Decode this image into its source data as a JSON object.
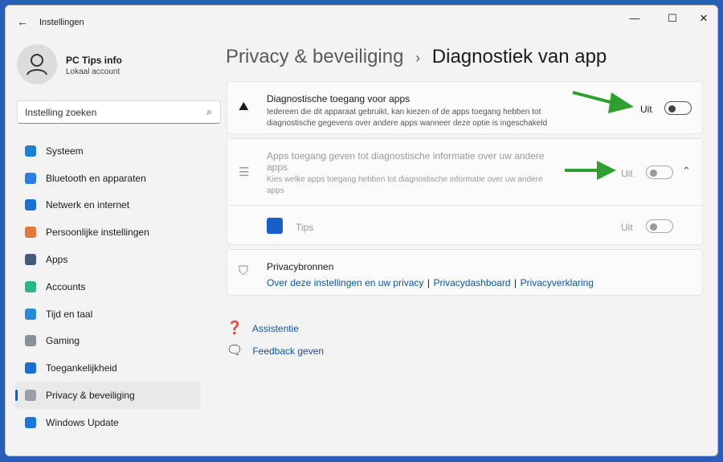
{
  "window": {
    "title": "Instellingen",
    "minimize": "—",
    "maximize": "☐",
    "close": "✕"
  },
  "user": {
    "name": "PC Tips info",
    "type": "Lokaal account"
  },
  "search": {
    "placeholder": "Instelling zoeken"
  },
  "sidebar": {
    "items": [
      {
        "label": "Systeem",
        "color": "#1f7fd0"
      },
      {
        "label": "Bluetooth en apparaten",
        "color": "#2b7de0"
      },
      {
        "label": "Netwerk en internet",
        "color": "#1d6fd6"
      },
      {
        "label": "Persoonlijke instellingen",
        "color": "#e07a3a"
      },
      {
        "label": "Apps",
        "color": "#445a7a"
      },
      {
        "label": "Accounts",
        "color": "#2bb58a"
      },
      {
        "label": "Tijd en taal",
        "color": "#2a8ad8"
      },
      {
        "label": "Gaming",
        "color": "#8a9098"
      },
      {
        "label": "Toegankelijkheid",
        "color": "#1a6fd0"
      },
      {
        "label": "Privacy & beveiliging",
        "color": "#9a9ea6",
        "selected": true
      },
      {
        "label": "Windows Update",
        "color": "#1b78d8"
      }
    ]
  },
  "breadcrumb": {
    "parent": "Privacy & beveiliging",
    "separator": "›",
    "current": "Diagnostiek van app"
  },
  "settings": {
    "diag": {
      "title": "Diagnostische toegang voor apps",
      "desc": "Iedereen die dit apparaat gebruikt, kan kiezen of de apps toegang hebben tot diagnostische gegevens over andere apps wanneer deze optie is ingeschakeld",
      "state": "Uit",
      "on": false
    },
    "apps": {
      "title": "Apps toegang geven tot diagnostische informatie over uw andere apps",
      "desc": "Kies welke apps toegang hebben tot diagnostische informatie over uw andere apps",
      "state": "Uit",
      "on": false,
      "expanded": true
    },
    "tips": {
      "name": "Tips",
      "state": "Uit",
      "on": false
    },
    "privacy": {
      "title": "Privacybronnen",
      "links": [
        "Over deze instellingen en uw privacy",
        "Privacydashboard",
        "Privacyverklaring"
      ],
      "sep": "|"
    }
  },
  "footer": {
    "help": "Assistentie",
    "feedback": "Feedback geven"
  },
  "colors": {
    "accent": "#0067c0",
    "arrow": "#2fa02f"
  }
}
